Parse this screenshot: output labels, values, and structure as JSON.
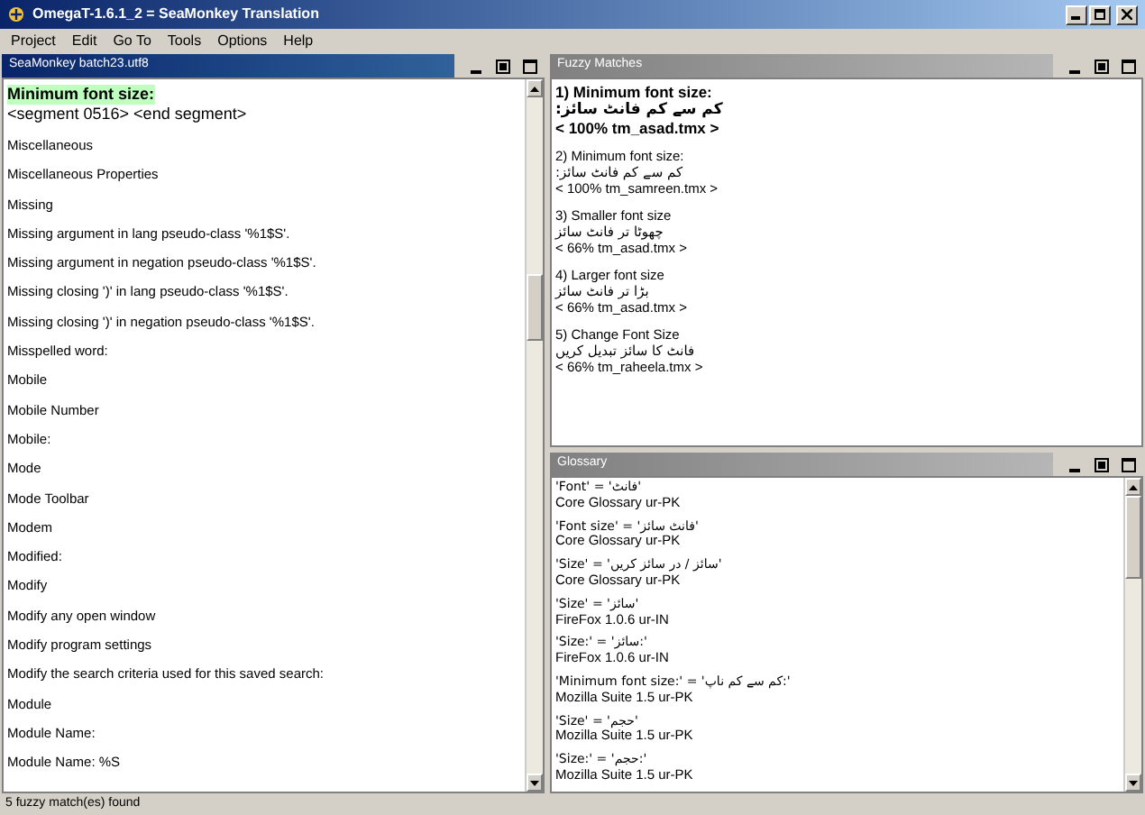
{
  "window": {
    "title": "OmegaT-1.6.1_2 = SeaMonkey Translation"
  },
  "menu": [
    "Project",
    "Edit",
    "Go To",
    "Tools",
    "Options",
    "Help"
  ],
  "editor": {
    "title": "SeaMonkey batch23.utf8",
    "current_segment": {
      "source": "Minimum font size:",
      "tag": "<segment 0516>  <end segment>"
    },
    "segments": [
      "Miscellaneous",
      "Miscellaneous Properties",
      "Missing",
      "Missing argument in lang pseudo-class '%1$S'.",
      "Missing argument in negation pseudo-class '%1$S'.",
      "Missing closing ')' in lang pseudo-class '%1$S'.",
      "Missing closing ')' in negation pseudo-class '%1$S'.",
      "Misspelled word:",
      "Mobile",
      "Mobile Number",
      "Mobile:",
      "Mode",
      "Mode Toolbar",
      "Modem",
      "Modified:",
      "Modify",
      "Modify any open window",
      "Modify program settings",
      "Modify the search criteria used for this saved search:",
      "Module",
      "Module Name:",
      "Module Name: %S"
    ]
  },
  "fuzzy_matches": {
    "title": "Fuzzy Matches",
    "matches": [
      {
        "source": "1) Minimum font size:",
        "target": "کم سے کم فانٹ سائز:",
        "info": "< 100% tm_asad.tmx >",
        "selected": true
      },
      {
        "source": "2) Minimum font size:",
        "target": "کم سے کم فانٹ سائز:",
        "info": "< 100% tm_samreen.tmx >",
        "selected": false
      },
      {
        "source": "3) Smaller font size",
        "target": "چھوٹا تر فانٹ سائز",
        "info": "< 66% tm_asad.tmx >",
        "selected": false
      },
      {
        "source": "4) Larger font size",
        "target": "بڑا تر فانٹ سائز",
        "info": "< 66% tm_asad.tmx >",
        "selected": false
      },
      {
        "source": "5) Change Font Size",
        "target": "فانٹ کا سائز تبدیل کریں",
        "info": "< 66% tm_raheela.tmx >",
        "selected": false
      }
    ]
  },
  "glossary": {
    "title": "Glossary",
    "entries": [
      {
        "term": "'Font' = 'فانٹ'",
        "origin": "Core Glossary ur-PK"
      },
      {
        "term": "'Font size' = 'فانٹ سائز'",
        "origin": "Core Glossary ur-PK"
      },
      {
        "term": "'Size' = 'سائز / در سائز کریں'",
        "origin": "Core Glossary ur-PK"
      },
      {
        "term": "'Size' = 'سائز'",
        "origin": "FireFox 1.0.6 ur-IN"
      },
      {
        "term": "'Size:' = 'سائز:'",
        "origin": "FireFox 1.0.6 ur-IN"
      },
      {
        "term": "'Minimum font size:' = 'کم سے کم ناپ:'",
        "origin": "Mozilla Suite 1.5 ur-PK"
      },
      {
        "term": "'Size' = 'حجم'",
        "origin": "Mozilla Suite 1.5 ur-PK"
      },
      {
        "term": "'Size:' = 'حجم:'",
        "origin": "Mozilla Suite 1.5 ur-PK"
      }
    ]
  },
  "status_bar": "5 fuzzy match(es) found"
}
